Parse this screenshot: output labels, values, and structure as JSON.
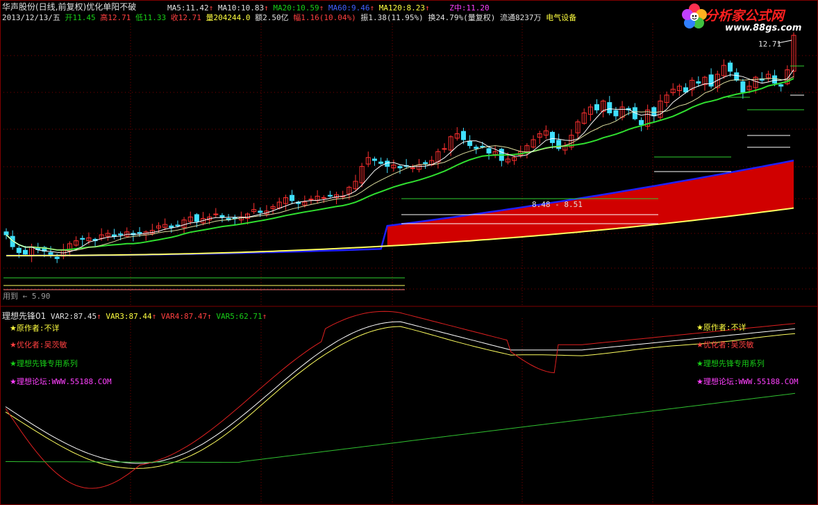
{
  "header": {
    "stock_title": "华声股份(日线,前复权)",
    "formula_name": "优化单阳不破",
    "ma5_label": "MA5:",
    "ma5_value": "11.42",
    "ma10_label": "MA10:",
    "ma10_value": "10.83",
    "ma20_label": "MA20:",
    "ma20_value": "10.59",
    "ma60_label": "MA60:",
    "ma60_value": "9.46",
    "ma120_label": "MA120:",
    "ma120_value": "8.23",
    "zmid_label": "Z中:",
    "zmid_value": "11.20",
    "arrow": "↑"
  },
  "quote": {
    "date": "2013/12/13/五",
    "open_label": "开",
    "open": "11.45",
    "high_label": "高",
    "high": "12.71",
    "low_label": "低",
    "low": "11.33",
    "close_label": "收",
    "close": "12.71",
    "vol_label": "量",
    "vol": "204244.0",
    "amount_label": "额",
    "amount": "2.50亿",
    "change_label": "幅",
    "change": "1.16(10.04%)",
    "amp_label": "振",
    "amp": "1.38(11.95%)",
    "turnover_label": "换",
    "turnover": "24.79%(量复权)",
    "float_label": "流通",
    "float": "8237万",
    "sector": "电气设备"
  },
  "chart_labels": {
    "peak_price": "12.71",
    "range_label": "8.48 - 8.51",
    "low_label": "用到 ← 5.90"
  },
  "indicator": {
    "name": "理想先锋01",
    "var2_label": "VAR2:",
    "var2": "87.45",
    "var3_label": "VAR3:",
    "var3": "87.44",
    "var4_label": "VAR4:",
    "var4": "87.47",
    "var5_label": "VAR5:",
    "var5": "62.71",
    "arrow": "↑"
  },
  "credits": {
    "star": "★",
    "author": "原作者:不详",
    "optimizer": "优化者:吴茨敏",
    "series": "理想先锋专用系列",
    "forum": "理想论坛:WWW.55188.COM"
  },
  "logo": {
    "name": "分析家公式网",
    "url": "www.88gs.com"
  },
  "colors": {
    "background": "#000000",
    "up_candle": "#ff3030",
    "down_candle": "#40e0ff",
    "ma_white": "#ffffff",
    "ma_green": "#30e030",
    "ma_blue": "#2020ff",
    "ma_yellow": "#ffff60",
    "fill_red": "#d00000",
    "grid": "#800000"
  }
}
